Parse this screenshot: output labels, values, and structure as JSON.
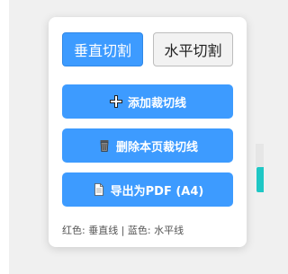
{
  "panel": {
    "mode_buttons": {
      "vertical_label": "垂直切割",
      "horizontal_label": "水平切割",
      "active": "vertical"
    },
    "actions": {
      "add_label": "添加裁切线",
      "add_icon": "crosshair-icon",
      "delete_label": "删除本页裁切线",
      "delete_icon": "trash-can-icon",
      "export_label": "导出为PDF (A4)",
      "export_icon": "document-icon"
    },
    "legend": "红色: 垂直线 | 蓝色: 水平线"
  },
  "colors": {
    "accent": "#3d9bff",
    "inactive_bg": "#f2f2f2",
    "scroll_accent": "#1fc7c5"
  }
}
